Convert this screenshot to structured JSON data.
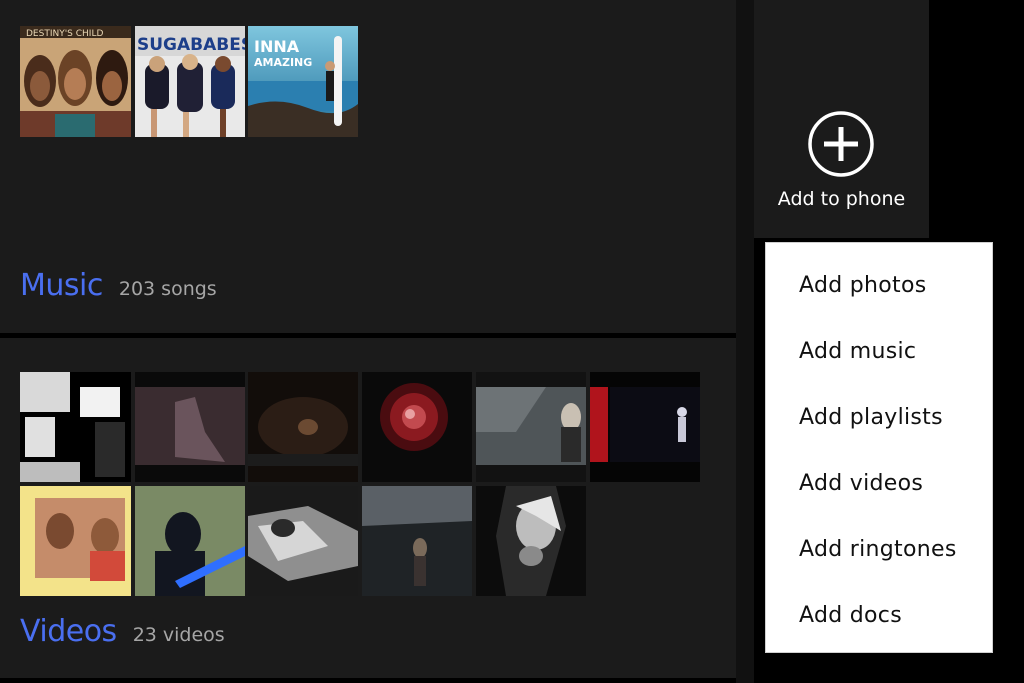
{
  "music": {
    "title": "Music",
    "count": "203 songs",
    "thumbnails": [
      {
        "name": "album-destinys-child",
        "caption": "DESTINY'S CHILD"
      },
      {
        "name": "album-sugababes",
        "caption": "SUGABABES"
      },
      {
        "name": "album-inna-amazing",
        "caption": "INNA",
        "subcaption": "AMAZING"
      }
    ]
  },
  "videos": {
    "title": "Videos",
    "count": "23 videos"
  },
  "add_tile": {
    "label": "Add to phone",
    "icon": "plus-circle-icon"
  },
  "menu": {
    "items": [
      {
        "label": "Add photos"
      },
      {
        "label": "Add music"
      },
      {
        "label": "Add playlists"
      },
      {
        "label": "Add videos"
      },
      {
        "label": "Add ringtones"
      },
      {
        "label": "Add docs"
      }
    ]
  },
  "colors": {
    "accent": "#4a6ff0",
    "panel": "#1b1b1b",
    "menu_bg": "#ffffff"
  }
}
